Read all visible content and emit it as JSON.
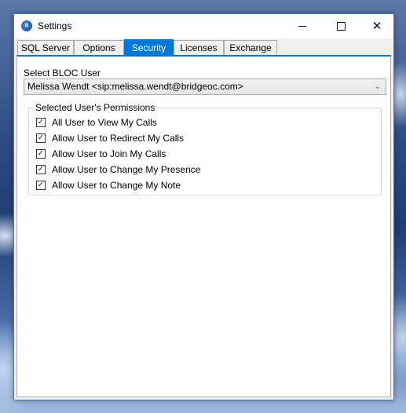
{
  "window": {
    "title": "Settings",
    "controls": {
      "minimize": "minimize",
      "maximize": "maximize",
      "close": "close"
    }
  },
  "tabs": [
    {
      "label": "SQL Server",
      "active": false
    },
    {
      "label": "Options",
      "active": false
    },
    {
      "label": "Security",
      "active": true
    },
    {
      "label": "Licenses",
      "active": false
    },
    {
      "label": "Exchange",
      "active": false
    }
  ],
  "security": {
    "select_label": "Select BLOC User",
    "selected_user": "Melissa Wendt <sip:melissa.wendt@bridgeoc.com>",
    "permissions_title": "Selected User's Permissions",
    "permissions": [
      {
        "label": "All User to View My Calls",
        "checked": true
      },
      {
        "label": "Allow User to Redirect My Calls",
        "checked": true
      },
      {
        "label": "Allow User to Join My Calls",
        "checked": true
      },
      {
        "label": "Allow User to Change My Presence",
        "checked": true
      },
      {
        "label": "Allow User to Change My Note",
        "checked": true
      }
    ]
  },
  "icons": {
    "app": "app-icon",
    "dropdown": "chevron-down-icon",
    "check": "checkmark-icon"
  },
  "colors": {
    "accent": "#0078d7",
    "window_border": "#3b7fc4"
  }
}
